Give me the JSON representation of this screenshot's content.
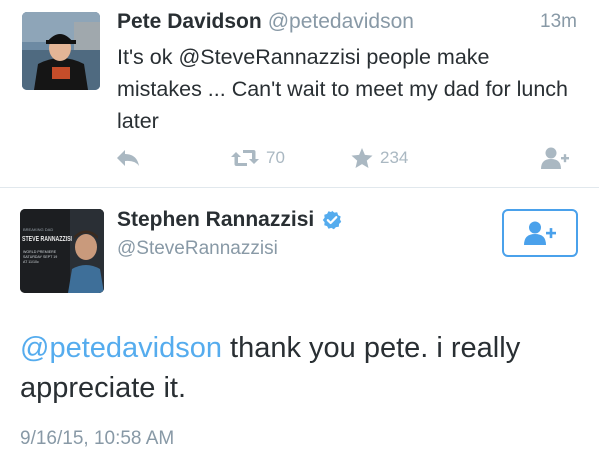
{
  "tweet1": {
    "display_name": "Pete Davidson",
    "handle": "@petedavidson",
    "time": "13m",
    "text": "It's ok @SteveRannazzisi people make mistakes ... Can't wait to meet my dad for lunch later",
    "retweet_count": "70",
    "favorite_count": "234",
    "icons": {
      "reply": "reply-icon",
      "retweet": "retweet-icon",
      "favorite": "star-icon",
      "follow": "add-user-icon"
    }
  },
  "tweet2": {
    "display_name": "Stephen Rannazzisi",
    "handle": "@SteveRannazzisi",
    "mention": "@petedavidson",
    "text_rest": " thank you pete.  i really appreciate it.",
    "date": "9/16/15, 10:58 AM",
    "verified_icon": "verified-badge-icon",
    "follow_icon": "add-user-icon",
    "avatar_text": {
      "small": "BREAKING DAD",
      "title": "STEVE RANNAZZISI",
      "premiere": "WORLD PREMIERE",
      "day": "SATURDAY SEPT 19",
      "time": "AT 11/10c"
    }
  },
  "colors": {
    "link": "#55acee",
    "muted": "#8899a6",
    "icon": "#aab8c2",
    "follow_border": "#4aa1eb",
    "text": "#292f33",
    "divider": "#e1e8ed"
  }
}
